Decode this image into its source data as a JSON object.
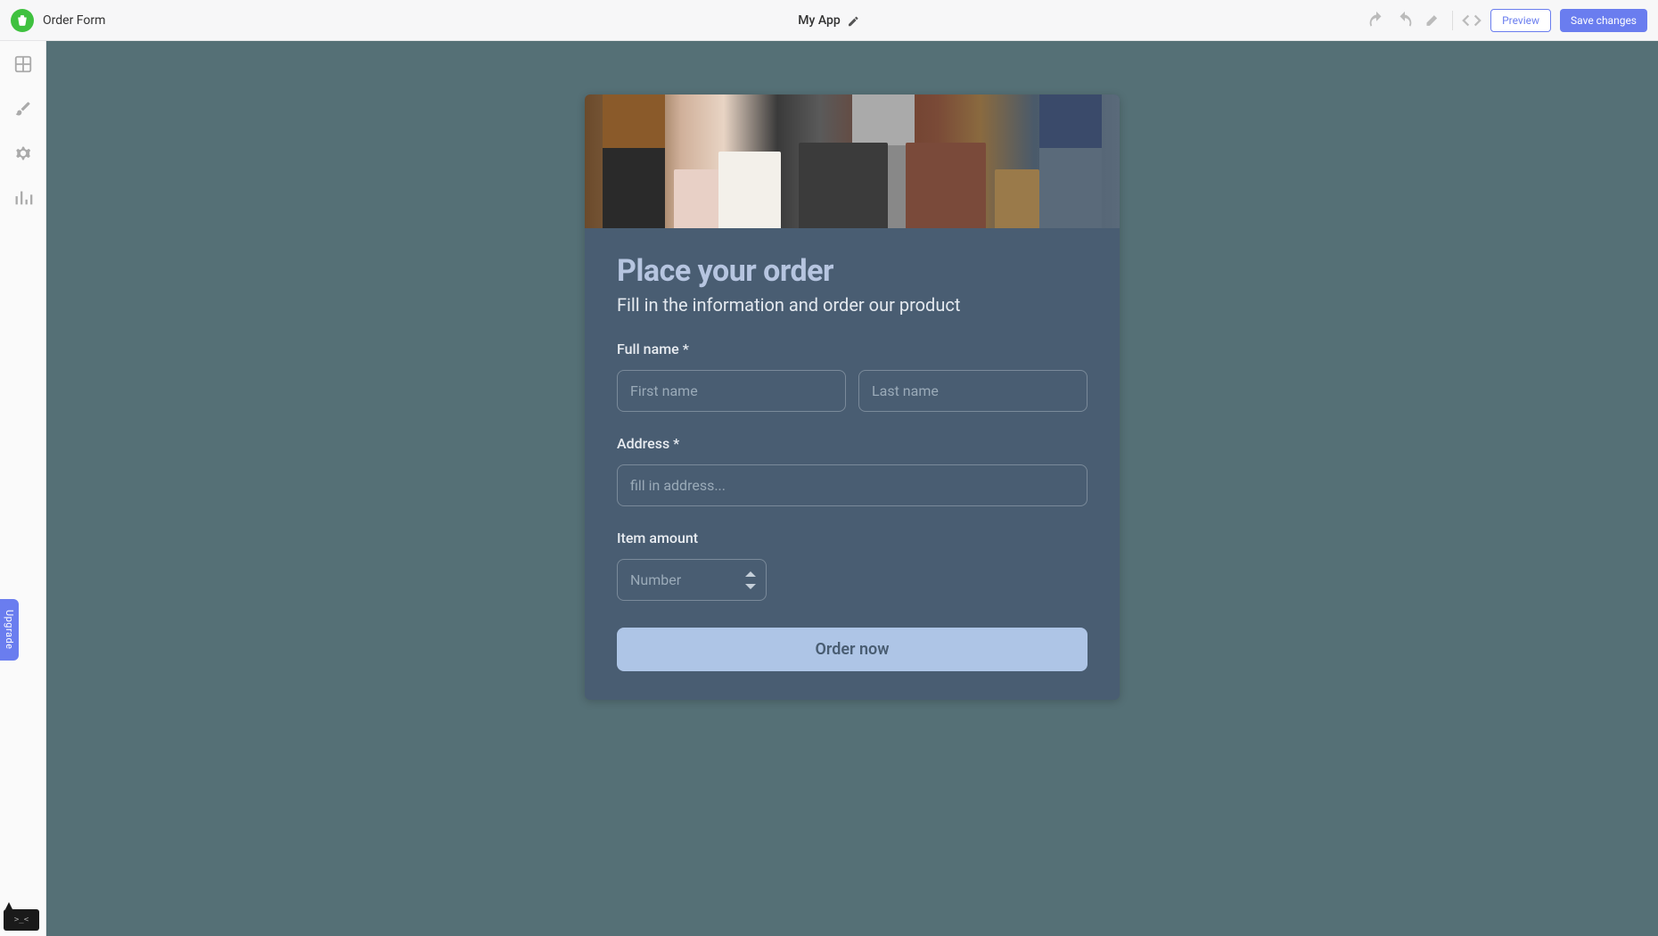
{
  "header": {
    "page_name": "Order Form",
    "app_name": "My App",
    "preview_label": "Preview",
    "save_label": "Save changes"
  },
  "sidebar": {
    "upgrade_label": "Upgrade"
  },
  "form": {
    "title": "Place your order",
    "subtitle": "Fill in the information and order our product",
    "full_name_label": "Full name *",
    "first_name_placeholder": "First name",
    "last_name_placeholder": "Last name",
    "address_label": "Address *",
    "address_placeholder": "fill in address...",
    "item_amount_label": "Item amount",
    "number_placeholder": "Number",
    "order_button_label": "Order now"
  }
}
